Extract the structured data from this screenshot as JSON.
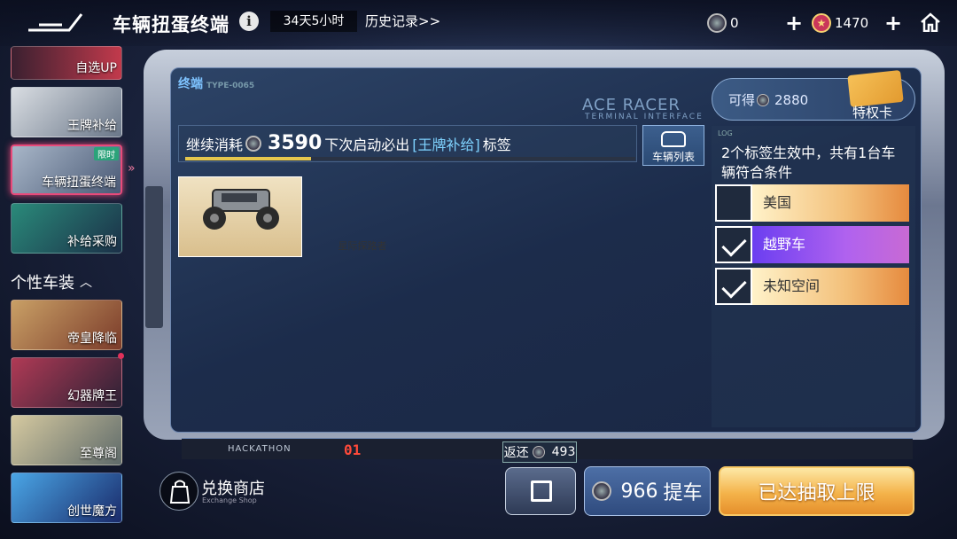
{
  "header": {
    "title": "车辆扭蛋终端",
    "timer": "34天5小时",
    "history_link": "历史记录>>",
    "coin_count": "0",
    "star_count": "1470"
  },
  "sidebar": {
    "items": [
      {
        "label": "自选UP",
        "badge": ""
      },
      {
        "label": "王牌补给",
        "badge": ""
      },
      {
        "label": "车辆扭蛋终端",
        "badge": "限时"
      },
      {
        "label": "补给采购",
        "badge": ""
      }
    ],
    "section_title": "个性车装",
    "section_items": [
      {
        "label": "帝皇降临"
      },
      {
        "label": "幻器牌王"
      },
      {
        "label": "至尊阁"
      },
      {
        "label": "创世魔方"
      }
    ]
  },
  "terminal": {
    "label": "终端",
    "type_code": "TYPE-0065",
    "brand": "ACE RACER",
    "brand_sub": "TERMINAL INTERFACE",
    "cost_prefix": "继续消耗",
    "cost_value": "3590",
    "cost_suffix": "下次启动必出",
    "cost_tag": "[王牌补给]",
    "cost_end": "标签",
    "progress_fraction": 0.28,
    "car_list_label": "车辆列表",
    "car_name": "星际探路者"
  },
  "panel": {
    "obtain_label": "可得",
    "obtain_value": "2880",
    "privilege_label": "特权卡",
    "log_tag": "LOG",
    "log_note": "2个标签生效中，共有1台车辆符合条件",
    "tags": [
      {
        "label": "美国",
        "checked": false,
        "style": "gold"
      },
      {
        "label": "越野车",
        "checked": true,
        "style": "purple"
      },
      {
        "label": "未知空间",
        "checked": true,
        "style": "gold"
      }
    ]
  },
  "footer": {
    "hackathon": "HACKATHON",
    "page_indicator": "01",
    "exchange_label": "兑换商店",
    "exchange_sub": "Exchange Shop",
    "return_label": "返还",
    "return_value": "493",
    "pick_value": "966",
    "pick_label": "提车",
    "limit_label": "已达抽取上限"
  }
}
